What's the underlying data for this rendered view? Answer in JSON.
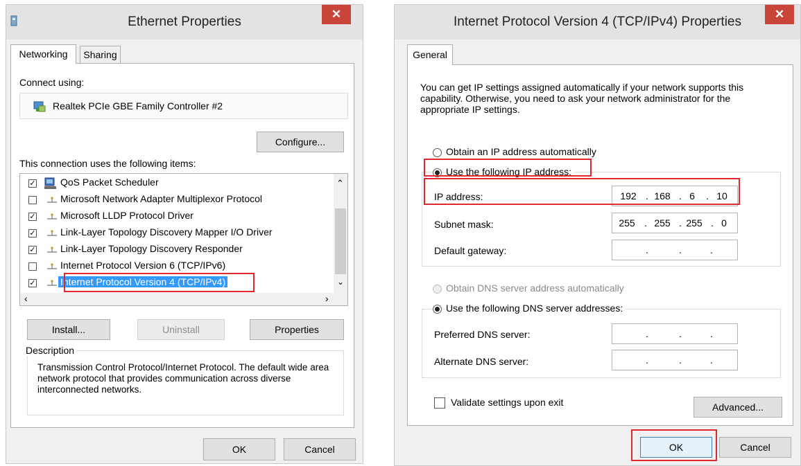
{
  "ethernet": {
    "title": "Ethernet Properties",
    "close_glyph": "✕",
    "tabs": [
      "Networking",
      "Sharing"
    ],
    "connect_using_label": "Connect using:",
    "adapter_name": "Realtek PCIe GBE Family Controller #2",
    "configure_label": "Configure...",
    "items_label": "This connection uses the following items:",
    "items": [
      {
        "label": "QoS Packet Scheduler",
        "checked": true
      },
      {
        "label": "Microsoft Network Adapter Multiplexor Protocol",
        "checked": false
      },
      {
        "label": "Microsoft LLDP Protocol Driver",
        "checked": true
      },
      {
        "label": "Link-Layer Topology Discovery Mapper I/O Driver",
        "checked": true
      },
      {
        "label": "Link-Layer Topology Discovery Responder",
        "checked": true
      },
      {
        "label": "Internet Protocol Version 6 (TCP/IPv6)",
        "checked": false
      },
      {
        "label": "Internet Protocol Version 4 (TCP/IPv4)",
        "checked": true
      }
    ],
    "install_label": "Install...",
    "uninstall_label": "Uninstall",
    "properties_label": "Properties",
    "description_heading": "Description",
    "description_text": "Transmission Control Protocol/Internet Protocol. The default wide area network protocol that provides communication across diverse interconnected networks.",
    "ok_label": "OK",
    "cancel_label": "Cancel"
  },
  "ipv4": {
    "title": "Internet Protocol Version 4 (TCP/IPv4) Properties",
    "close_glyph": "✕",
    "tab_general": "General",
    "intro": "You can get IP settings assigned automatically if your network supports this capability. Otherwise, you need to ask your network administrator for the appropriate IP settings.",
    "obtain_ip_auto": "Obtain an IP address automatically",
    "use_following_ip": "Use the following IP address:",
    "ip_address_label": "IP address:",
    "ip_address": [
      "192",
      "168",
      "6",
      "10"
    ],
    "subnet_mask_label": "Subnet mask:",
    "subnet_mask": [
      "255",
      "255",
      "255",
      "0"
    ],
    "default_gateway_label": "Default gateway:",
    "obtain_dns_auto": "Obtain DNS server address automatically",
    "use_following_dns": "Use the following DNS server addresses:",
    "preferred_dns_label": "Preferred DNS server:",
    "alternate_dns_label": "Alternate DNS server:",
    "validate_label": "Validate settings upon exit",
    "advanced_label": "Advanced...",
    "ok_label": "OK",
    "cancel_label": "Cancel"
  },
  "colors": {
    "highlight_red": "#e0282e",
    "selection_blue": "#3399ff",
    "close_red": "#c9453a"
  }
}
